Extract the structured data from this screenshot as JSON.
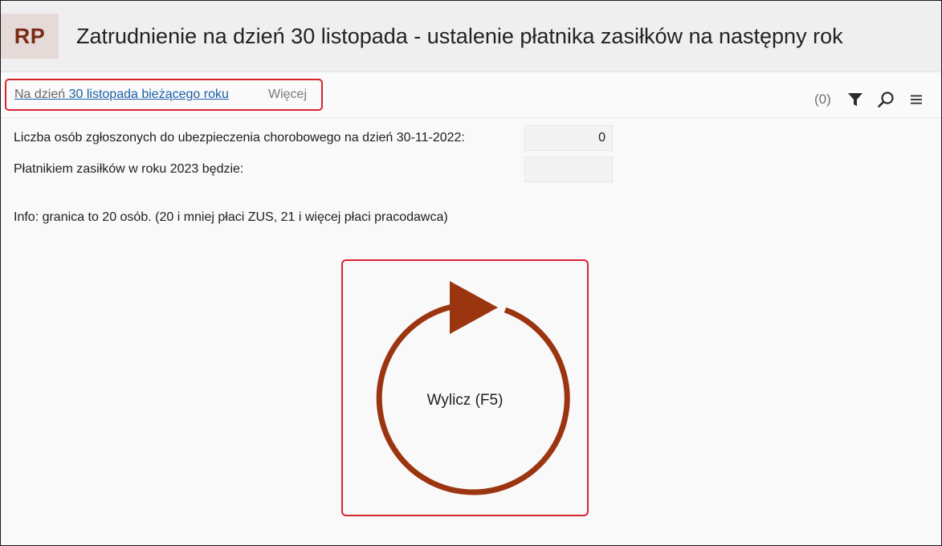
{
  "header": {
    "badge": "RP",
    "title": "Zatrudnienie na dzień 30 listopada - ustalenie płatnika zasiłków na następny rok"
  },
  "toolbar": {
    "breadcrumb_prefix": "Na dzień",
    "breadcrumb_link": "30 listopada bieżącego roku",
    "more": "Więcej",
    "count": "(0)",
    "icons": [
      "filter-icon",
      "search-icon",
      "menu-icon"
    ]
  },
  "form": {
    "insured_count_label": "Liczba osób zgłoszonych do ubezpieczenia chorobowego na dzień 30-11-2022:",
    "insured_count_value": "0",
    "payer_label": "Płatnikiem zasiłków w roku 2023 będzie:",
    "payer_value": ""
  },
  "info": "Info: granica to 20 osób. (20 i mniej płaci ZUS, 21 i więcej płaci pracodawca)",
  "action": {
    "label": "Wylicz (F5)",
    "icon": "refresh-play-icon",
    "color": "#9b3510"
  },
  "colors": {
    "accent": "#9b3510",
    "highlight": "#d9232f",
    "link": "#1a5fa8"
  }
}
